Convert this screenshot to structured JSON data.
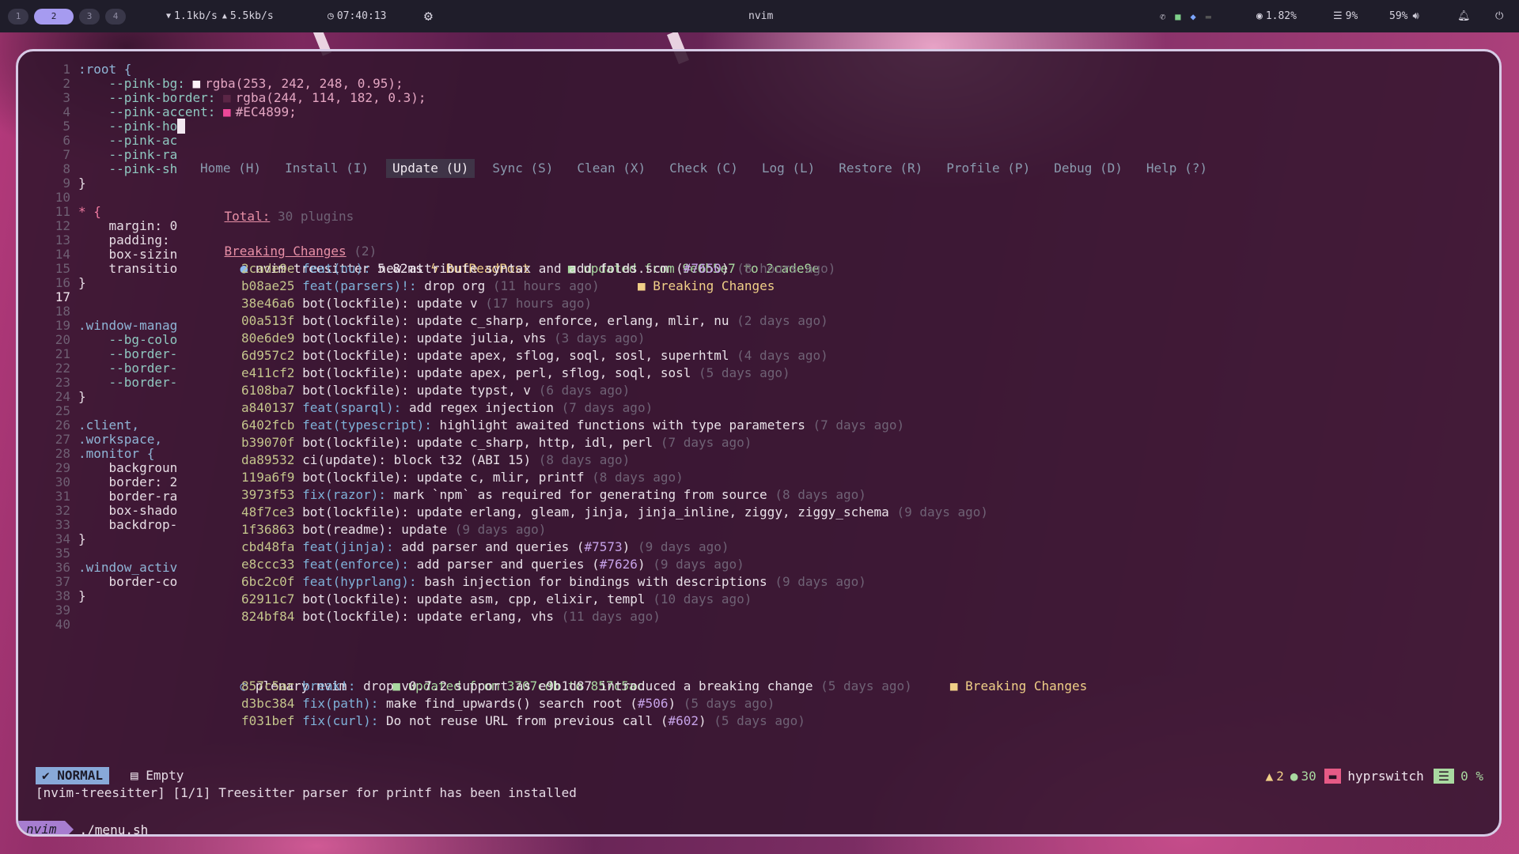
{
  "topbar": {
    "workspaces": [
      "1",
      "2",
      "3",
      "4"
    ],
    "active_workspace": "2",
    "net_down": "1.1kb/s",
    "net_up": "5.5kb/s",
    "clock": "07:40:13",
    "window_title": "nvim",
    "cpu": "1.82%",
    "mem": "9%",
    "volume": "59%"
  },
  "editor": {
    "lines": [
      {
        "n": "1",
        "text": ":root {"
      },
      {
        "n": "2",
        "text": "    --pink-bg: ",
        "color_text": "rgba(253, 242, 248, 0.95);",
        "swatch": "#fdf2f8"
      },
      {
        "n": "3",
        "text": "    --pink-border: ",
        "color_text": "rgba(244, 114, 182, 0.3);",
        "swatch": "#5b2646"
      },
      {
        "n": "4",
        "text": "    --pink-accent: ",
        "color_text": "#EC4899;",
        "swatch": "#ec4899"
      },
      {
        "n": "5",
        "text": "    --pink-ho"
      },
      {
        "n": "6",
        "text": "    --pink-ac"
      },
      {
        "n": "7",
        "text": "    --pink-ra"
      },
      {
        "n": "8",
        "text": "    --pink-sh"
      },
      {
        "n": "9",
        "text": "}"
      },
      {
        "n": "10",
        "text": ""
      },
      {
        "n": "11",
        "text": "* {"
      },
      {
        "n": "12",
        "text": "    margin: 0"
      },
      {
        "n": "13",
        "text": "    padding:"
      },
      {
        "n": "14",
        "text": "    box-sizin"
      },
      {
        "n": "15",
        "text": "    transitio"
      },
      {
        "n": "16",
        "text": "}"
      },
      {
        "n": "17",
        "text": ""
      },
      {
        "n": "18",
        "text": ""
      },
      {
        "n": "19",
        "text": ".window-manag"
      },
      {
        "n": "20",
        "text": "    --bg-colo"
      },
      {
        "n": "21",
        "text": "    --border-"
      },
      {
        "n": "22",
        "text": "    --border-"
      },
      {
        "n": "23",
        "text": "    --border-"
      },
      {
        "n": "24",
        "text": "}"
      },
      {
        "n": "25",
        "text": ""
      },
      {
        "n": "26",
        "text": ".client,"
      },
      {
        "n": "27",
        "text": ".workspace,"
      },
      {
        "n": "28",
        "text": ".monitor {"
      },
      {
        "n": "29",
        "text": "    backgroun"
      },
      {
        "n": "30",
        "text": "    border: 2"
      },
      {
        "n": "31",
        "text": "    border-ra"
      },
      {
        "n": "32",
        "text": "    box-shado"
      },
      {
        "n": "33",
        "text": "    backdrop-"
      },
      {
        "n": "34",
        "text": "}"
      },
      {
        "n": "35",
        "text": ""
      },
      {
        "n": "36",
        "text": ".window_activ"
      },
      {
        "n": "37",
        "text": "    border-co"
      },
      {
        "n": "38",
        "text": "}"
      },
      {
        "n": "39",
        "text": ""
      },
      {
        "n": "40",
        "text": ""
      }
    ],
    "current_line": "17"
  },
  "lazy": {
    "menu": [
      "Home (H)",
      "Install (I)",
      "Update (U)",
      "Sync (S)",
      "Clean (X)",
      "Check (C)",
      "Log (L)",
      "Restore (R)",
      "Profile (P)",
      "Debug (D)",
      "Help (?)"
    ],
    "active_menu": "Update (U)",
    "total_label": "Total:",
    "total_value": "30 plugins",
    "section_title": "Breaking Changes",
    "section_count": "(2)",
    "plugin1": {
      "name": "nvim-treesitter",
      "time": "5.82ms",
      "event": "BufReadPost",
      "status": "updated from 9e0b5e7 to 2cade9e"
    },
    "commits1": [
      {
        "hash": "2cade9e",
        "type": "feat(nu):",
        "msg": " new attribute syntax and add folds.scm (",
        "issue": "#7650",
        "tail": ")",
        "age": "(8 hours ago)"
      },
      {
        "hash": "b08ae25",
        "type": "feat(parsers)!:",
        "msg": " drop org",
        "age": "(11 hours ago)",
        "breaking": "Breaking Changes"
      },
      {
        "hash": "38e46a6",
        "type": "bot(lockfile):",
        "msg": " update v",
        "age": "(17 hours ago)",
        "plain": true
      },
      {
        "hash": "00a513f",
        "type": "bot(lockfile):",
        "msg": " update c_sharp, enforce, erlang, mlir, nu",
        "age": "(2 days ago)",
        "plain": true
      },
      {
        "hash": "80e6de9",
        "type": "bot(lockfile):",
        "msg": " update julia, vhs",
        "age": "(3 days ago)",
        "plain": true
      },
      {
        "hash": "6d957c2",
        "type": "bot(lockfile):",
        "msg": " update apex, sflog, soql, sosl, superhtml",
        "age": "(4 days ago)",
        "plain": true
      },
      {
        "hash": "e411cf2",
        "type": "bot(lockfile):",
        "msg": " update apex, perl, sflog, soql, sosl",
        "age": "(5 days ago)",
        "plain": true
      },
      {
        "hash": "6108ba7",
        "type": "bot(lockfile):",
        "msg": " update typst, v",
        "age": "(6 days ago)",
        "plain": true
      },
      {
        "hash": "a840137",
        "type": "feat(sparql):",
        "msg": " add regex injection",
        "age": "(7 days ago)"
      },
      {
        "hash": "6402fcb",
        "type": "feat(typescript):",
        "msg": " highlight awaited functions with type parameters",
        "age": "(7 days ago)"
      },
      {
        "hash": "b39070f",
        "type": "bot(lockfile):",
        "msg": " update c_sharp, http, idl, perl",
        "age": "(7 days ago)",
        "plain": true
      },
      {
        "hash": "da89532",
        "type": "ci(update):",
        "msg": " block t32 (ABI 15)",
        "age": "(8 days ago)",
        "plain": true
      },
      {
        "hash": "119a6f9",
        "type": "bot(lockfile):",
        "msg": " update c, mlir, printf",
        "age": "(8 days ago)",
        "plain": true
      },
      {
        "hash": "3973f53",
        "type": "fix(razor):",
        "msg": " mark `npm` as required for generating from source",
        "age": "(8 days ago)"
      },
      {
        "hash": "48f7ce3",
        "type": "bot(lockfile):",
        "msg": " update erlang, gleam, jinja, jinja_inline, ziggy, ziggy_schema",
        "age": "(9 days ago)",
        "plain": true
      },
      {
        "hash": "1f36863",
        "type": "bot(readme):",
        "msg": " update",
        "age": "(9 days ago)",
        "plain": true
      },
      {
        "hash": "cbd48fa",
        "type": "feat(jinja):",
        "msg": " add parser and queries (",
        "issue": "#7573",
        "tail": ")",
        "age": "(9 days ago)"
      },
      {
        "hash": "e8ccc33",
        "type": "feat(enforce):",
        "msg": " add parser and queries (",
        "issue": "#7626",
        "tail": ")",
        "age": "(9 days ago)"
      },
      {
        "hash": "6bc2c0f",
        "type": "feat(hyprlang):",
        "msg": " bash injection for bindings with descriptions",
        "age": "(9 days ago)"
      },
      {
        "hash": "62911c7",
        "type": "bot(lockfile):",
        "msg": " update asm, cpp, elixir, templ",
        "age": "(10 days ago)",
        "plain": true
      },
      {
        "hash": "824bf84",
        "type": "bot(lockfile):",
        "msg": " update erlang, vhs",
        "age": "(11 days ago)",
        "plain": true
      }
    ],
    "plugin2": {
      "name": "plenary.nvim",
      "status": "updated from 3707cdb to 857c5ac"
    },
    "commits2": [
      {
        "hash": "857c5ac",
        "type": "break!:",
        "msg": " drop v0.7.2 support as e9b1d87 introduced a breaking change",
        "age": "(5 days ago)",
        "breaking": "Breaking Changes"
      },
      {
        "hash": "d3bc384",
        "type": "fix(path):",
        "msg": " make find_upwards() search root (",
        "issue": "#506",
        "tail": ")",
        "age": "(5 days ago)"
      },
      {
        "hash": "f031bef",
        "type": "fix(curl):",
        "msg": " Do not reuse URL from previous call (",
        "issue": "#602",
        "tail": ")",
        "age": "(5 days ago)"
      }
    ]
  },
  "statusline": {
    "mode": "NORMAL",
    "buffer": "Empty",
    "warnings": "2",
    "infos": "30",
    "project": "hyprswitch",
    "progress": "0 %"
  },
  "message": "[nvim-treesitter] [1/1] Treesitter parser for printf has been installed",
  "tmux": {
    "tab": "nvim",
    "command": "./menu.sh"
  }
}
